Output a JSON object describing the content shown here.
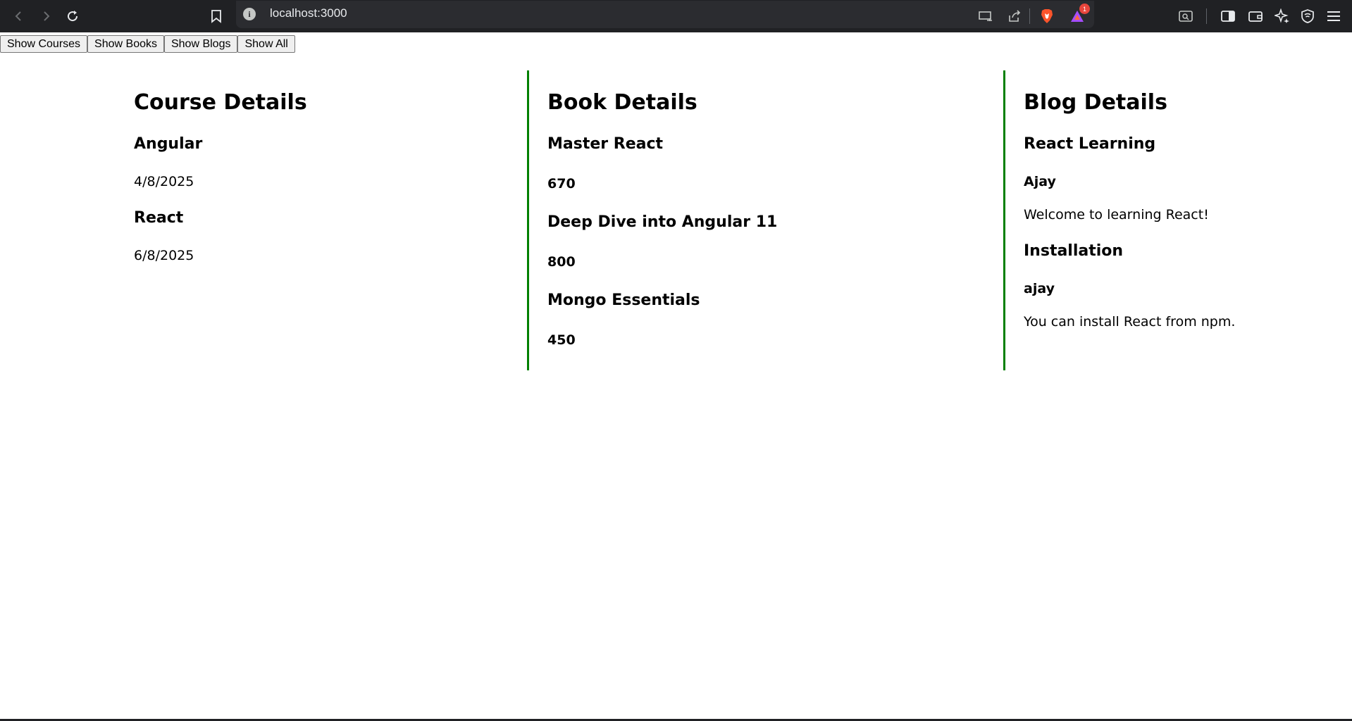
{
  "browser": {
    "url": "localhost:3000",
    "notification_count": "1",
    "icons": [
      "back-icon",
      "forward-icon",
      "reload-icon",
      "bookmark-icon",
      "site-info-icon",
      "cast-icon",
      "share-icon",
      "brave-shields-icon",
      "brave-rewards-icon",
      "tab-search-icon",
      "sidebar-icon",
      "wallet-icon",
      "leo-ai-icon",
      "vpn-icon",
      "menu-icon"
    ]
  },
  "buttons": {
    "show_courses": "Show Courses",
    "show_books": "Show Books",
    "show_blogs": "Show Blogs",
    "show_all": "Show All"
  },
  "courses": {
    "title": "Course Details",
    "items": [
      {
        "name": "Angular",
        "date": "4/8/2025"
      },
      {
        "name": "React",
        "date": "6/8/2025"
      }
    ]
  },
  "books": {
    "title": "Book Details",
    "items": [
      {
        "name": "Master React",
        "price": "670"
      },
      {
        "name": "Deep Dive into Angular 11",
        "price": "800"
      },
      {
        "name": "Mongo Essentials",
        "price": "450"
      }
    ]
  },
  "blogs": {
    "title": "Blog Details",
    "items": [
      {
        "title": "React Learning",
        "author": "Ajay",
        "content": "Welcome to learning React!"
      },
      {
        "title": "Installation",
        "author": "ajay",
        "content": "You can install React from npm."
      }
    ]
  },
  "colors": {
    "chrome_bg": "#202124",
    "divider": "#008000"
  }
}
